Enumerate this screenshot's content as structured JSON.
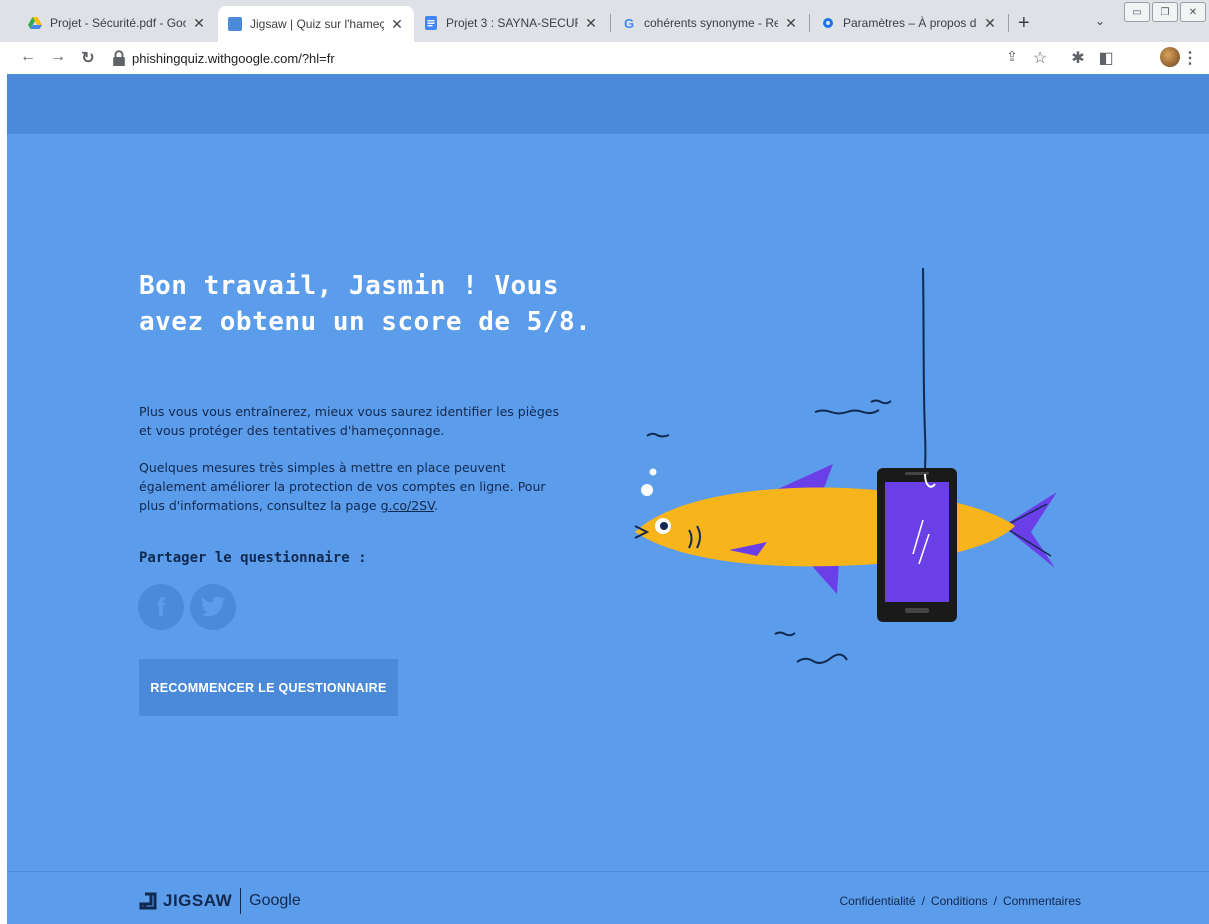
{
  "tabs": [
    {
      "title": "Projet - Sécurité.pdf - Goog",
      "icon": "google-drive-icon"
    },
    {
      "title": "Jigsaw | Quiz sur l'hameçon",
      "icon": "jigsaw-icon",
      "active": true
    },
    {
      "title": "Projet 3 : SAYNA-SECURITE",
      "icon": "google-docs-icon"
    },
    {
      "title": "cohérents synonyme - Rech",
      "icon": "google-g-icon"
    },
    {
      "title": "Paramètres – À propos de C",
      "icon": "settings-gear-icon"
    }
  ],
  "toolbar": {
    "url": "phishingquiz.withgoogle.com/?hl=fr"
  },
  "result": {
    "headline": "Bon travail, Jasmin ! Vous avez obtenu un score de 5/8.",
    "para1": "Plus vous vous entraînerez, mieux vous saurez identifier les pièges et vous protéger des tentatives d'hameçonnage.",
    "para2_prefix": "Quelques mesures très simples à mettre en place peuvent également améliorer la protection de vos comptes en ligne. Pour plus d'informations, consultez la page ",
    "para2_link": "g.co/2SV",
    "para2_suffix": ".",
    "share_label": "Partager le questionnaire :",
    "facebook_glyph": "f",
    "twitter_glyph": "🐦",
    "restart_label": "RECOMMENCER LE QUESTIONNAIRE"
  },
  "footer": {
    "logo_jigsaw": "JIGSAW",
    "logo_google": "Google",
    "links": [
      "Confidentialité",
      "Conditions",
      "Commentaires"
    ],
    "separator": "/"
  },
  "colors": {
    "page_bg": "#5b9ceb",
    "header_bg": "#4a8ad9",
    "text_dark": "#12294f",
    "fish": "#f7b51b",
    "fin": "#6b3fe8",
    "phone_screen": "#6b3fe8"
  }
}
